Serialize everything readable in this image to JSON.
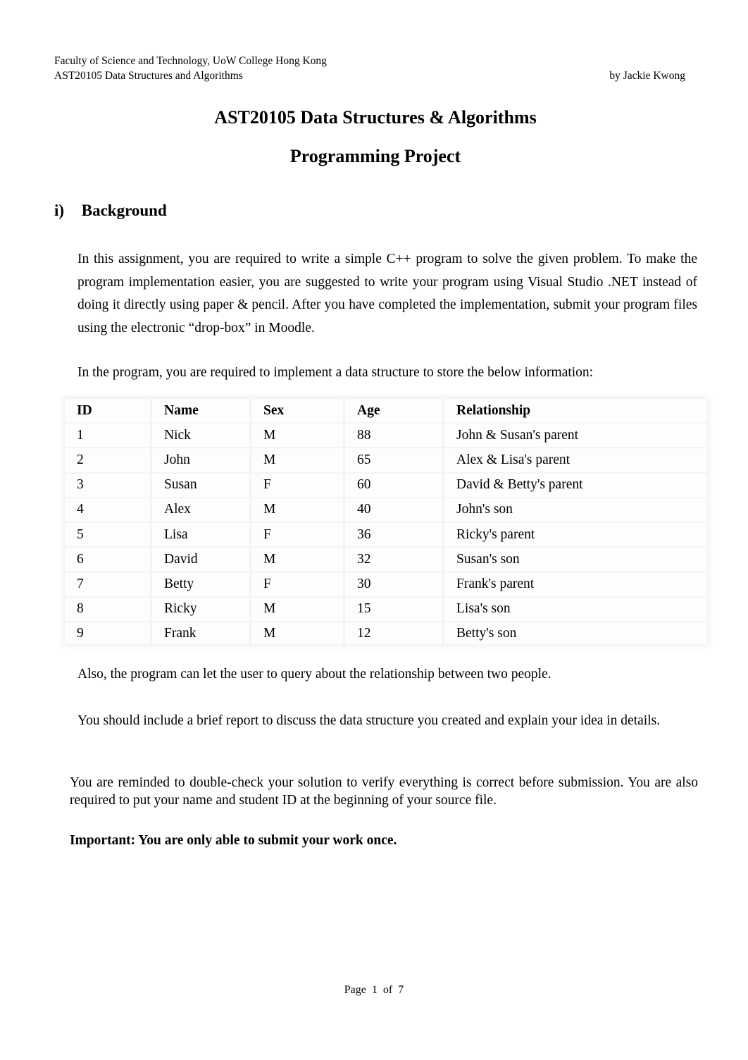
{
  "header": {
    "institution": "Faculty of Science and Technology, UoW College Hong Kong",
    "course": "AST20105 Data Structures and Algorithms",
    "author": "by Jackie Kwong"
  },
  "title": {
    "line1": "AST20105 Data Structures & Algorithms",
    "line2": "Programming Project"
  },
  "section": {
    "number": "i)",
    "heading": "Background"
  },
  "paragraphs": {
    "intro": "In this assignment, you are required to write a simple C++ program to solve the given problem. To make the program implementation easier, you are suggested to write your program using Visual Studio .NET instead of doing it directly using paper & pencil. After you have completed the implementation, submit your program files using the electronic “drop-box” in Moodle.",
    "table_intro": "In the program, you are required to implement a data structure to store the below information:",
    "query": "Also, the program can let the user to query about the relationship between two people.",
    "report": "You should include a brief report to discuss the data structure you created and explain your idea in details.",
    "reminder": "You are reminded to double-check your solution to verify everything is correct before submission. You are also required to put your name and student ID at the beginning of your source file.",
    "important": "Important: You are only able to submit your work once."
  },
  "table": {
    "columns": [
      "ID",
      "Name",
      "Sex",
      "Age",
      "Relationship"
    ],
    "rows": [
      [
        "1",
        "Nick",
        "M",
        "88",
        "John & Susan's parent"
      ],
      [
        "2",
        "John",
        "M",
        "65",
        "Alex & Lisa's parent"
      ],
      [
        "3",
        "Susan",
        "F",
        "60",
        "David & Betty's parent"
      ],
      [
        "4",
        "Alex",
        "M",
        "40",
        "John's son"
      ],
      [
        "5",
        "Lisa",
        "F",
        "36",
        "Ricky's parent"
      ],
      [
        "6",
        "David",
        "M",
        "32",
        "Susan's son"
      ],
      [
        "7",
        "Betty",
        "F",
        "30",
        "Frank's parent"
      ],
      [
        "8",
        "Ricky",
        "M",
        "15",
        "Lisa's son"
      ],
      [
        "9",
        "Frank",
        "M",
        "12",
        "Betty's son"
      ]
    ]
  },
  "footer": {
    "page_label": "Page 1 of 7"
  }
}
